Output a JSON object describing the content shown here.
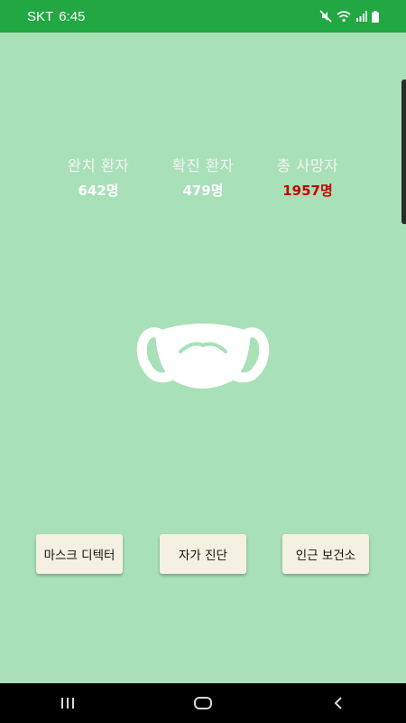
{
  "status_bar": {
    "carrier": "SKT",
    "time": "6:45",
    "icons": [
      "mute-icon",
      "wifi-icon",
      "signal-icon",
      "battery-icon"
    ]
  },
  "stats": {
    "recovered": {
      "label": "완치 환자",
      "value": "642명"
    },
    "confirmed": {
      "label": "확진 환자",
      "value": "479명"
    },
    "deaths": {
      "label": "총 사망자",
      "value": "1957명",
      "color": "#c40000"
    }
  },
  "center_icon": "mask-icon",
  "buttons": {
    "mask_detector": "마스크 디텍터",
    "self_diagnosis": "자가 진단",
    "nearby_clinic": "인근 보건소"
  },
  "nav_bar": {
    "icons": [
      "recent-apps-icon",
      "home-icon",
      "back-icon"
    ]
  },
  "colors": {
    "background": "#a8e0b8",
    "status_bar": "#22a842",
    "button": "#f4f1e2"
  }
}
